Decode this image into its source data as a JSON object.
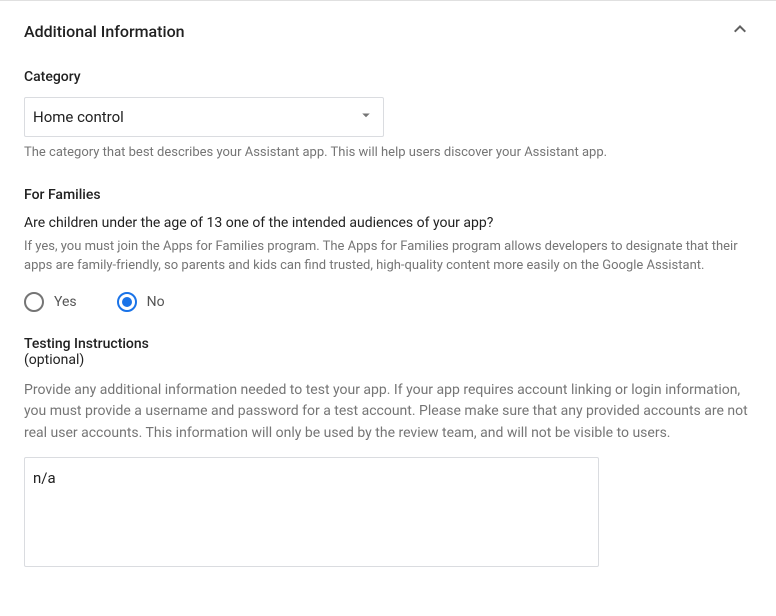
{
  "panel": {
    "title": "Additional Information"
  },
  "category": {
    "label": "Category",
    "selected": "Home control",
    "helper": "The category that best describes your Assistant app. This will help users discover your Assistant app."
  },
  "families": {
    "label": "For Families",
    "question": "Are children under the age of 13 one of the intended audiences of your app?",
    "helper": "If yes, you must join the Apps for Families program. The Apps for Families program allows developers to designate that their apps are family-friendly, so parents and kids can find trusted, high-quality content more easily on the Google Assistant.",
    "options": {
      "yes": "Yes",
      "no": "No"
    },
    "selected": "no"
  },
  "testing": {
    "label_line1": "Testing Instructions",
    "label_line2": "(optional)",
    "description": "Provide any additional information needed to test your app. If your app requires account linking or login information, you must provide a username and password for a test account. Please make sure that any provided accounts are not real user accounts. This information will only be used by the review team, and will not be visible to users.",
    "value": "n/a"
  }
}
